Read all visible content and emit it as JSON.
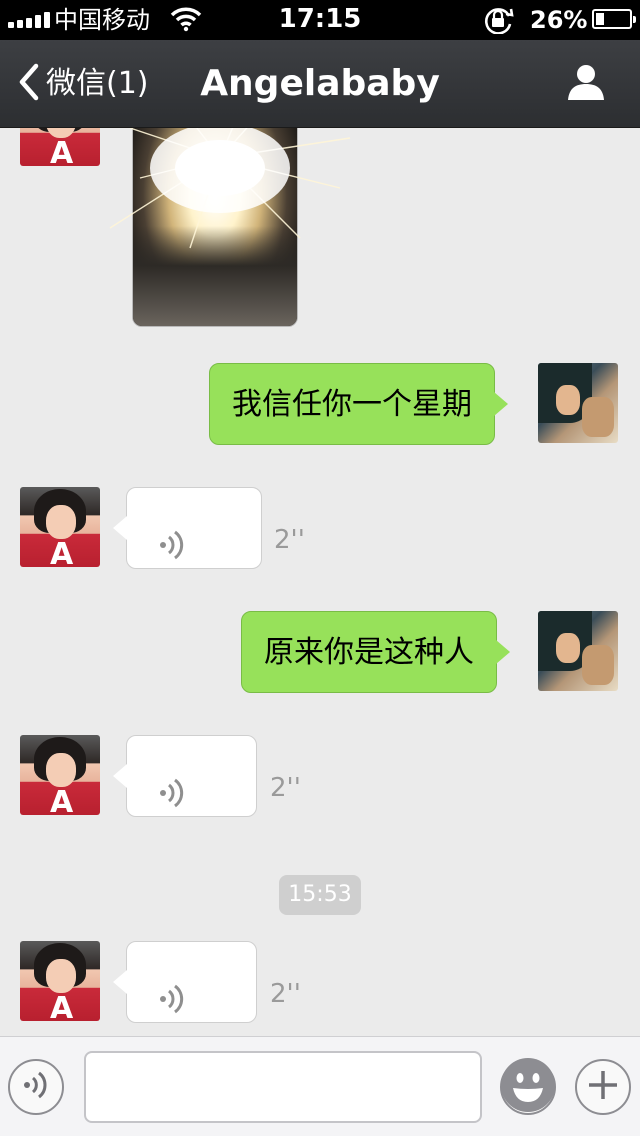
{
  "status_bar": {
    "carrier": "中国移动",
    "time": "17:15",
    "battery_percent": "26%",
    "battery_level": 0.26,
    "icons": [
      "signal-icon",
      "wifi-icon",
      "rotation-lock-icon",
      "battery-icon"
    ]
  },
  "nav": {
    "back_label": "微信(1)",
    "title": "Angelababy",
    "profile_icon": "person-icon"
  },
  "messages": [
    {
      "sender": "contact",
      "type": "image"
    },
    {
      "sender": "me",
      "type": "text",
      "text": "我信任你一个星期"
    },
    {
      "sender": "contact",
      "type": "voice",
      "duration": "2''"
    },
    {
      "sender": "me",
      "type": "text",
      "text": "原来你是这种人"
    },
    {
      "sender": "contact",
      "type": "voice",
      "duration": "2''"
    },
    {
      "sender": "system",
      "type": "timestamp",
      "text": "15:53"
    },
    {
      "sender": "contact",
      "type": "voice",
      "duration": "2''"
    }
  ],
  "input_bar": {
    "voice_icon": "voice-mode-icon",
    "emoji_icon": "emoji-icon",
    "more_icon": "plus-icon",
    "text_value": ""
  },
  "colors": {
    "nav_bg": "#35373b",
    "outgoing_bubble": "#97e15a",
    "incoming_bubble": "#ffffff",
    "chat_bg": "#ebebeb"
  }
}
